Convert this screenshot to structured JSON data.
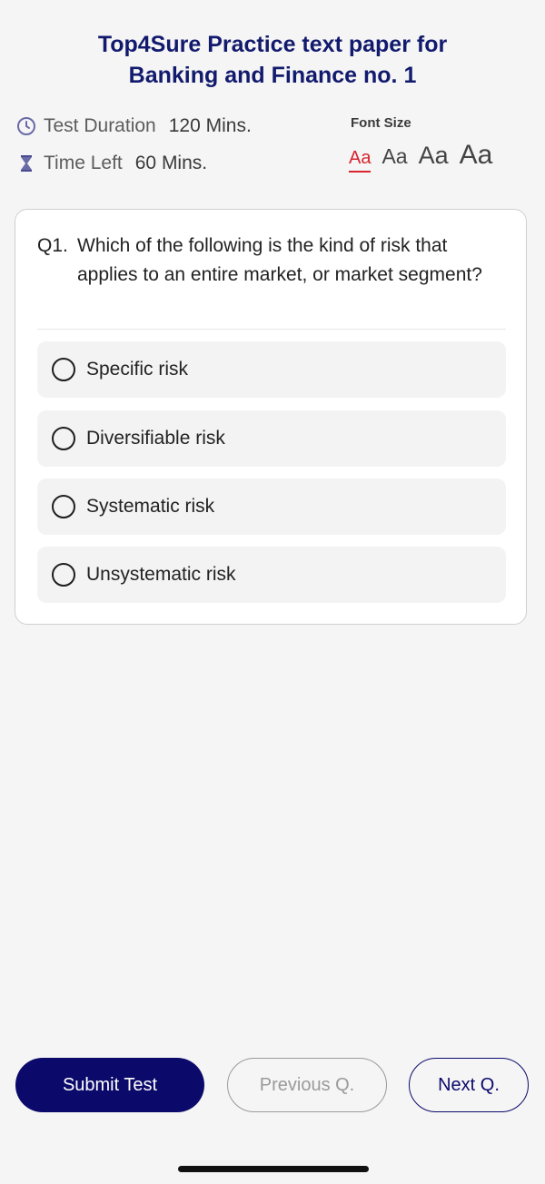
{
  "header": {
    "title_line1": "Top4Sure Practice text paper for",
    "title_line2": "Banking and Finance no. 1"
  },
  "test_info": {
    "duration_label": "Test Duration",
    "duration_value": "120 Mins.",
    "time_left_label": "Time Left",
    "time_left_value": "60 Mins.",
    "duration_icon": "clock-icon",
    "time_left_icon": "hourglass-icon"
  },
  "font_size": {
    "label": "Font Size",
    "options": [
      "Aa",
      "Aa",
      "Aa",
      "Aa"
    ],
    "selected_index": 0
  },
  "question": {
    "number": "Q1.",
    "text": "Which of the following is the kind of risk that applies to an entire market, or market segment?",
    "options": [
      {
        "label": "Specific risk"
      },
      {
        "label": "Diversifiable risk"
      },
      {
        "label": "Systematic risk"
      },
      {
        "label": "Unsystematic risk"
      }
    ]
  },
  "footer": {
    "submit_label": "Submit Test",
    "previous_label": "Previous Q.",
    "next_label": "Next Q."
  },
  "colors": {
    "brand_navy": "#0b0a6b",
    "title_navy": "#121a6d",
    "active_font_red": "#d9232d",
    "icon_purple": "#6a6aa8"
  }
}
